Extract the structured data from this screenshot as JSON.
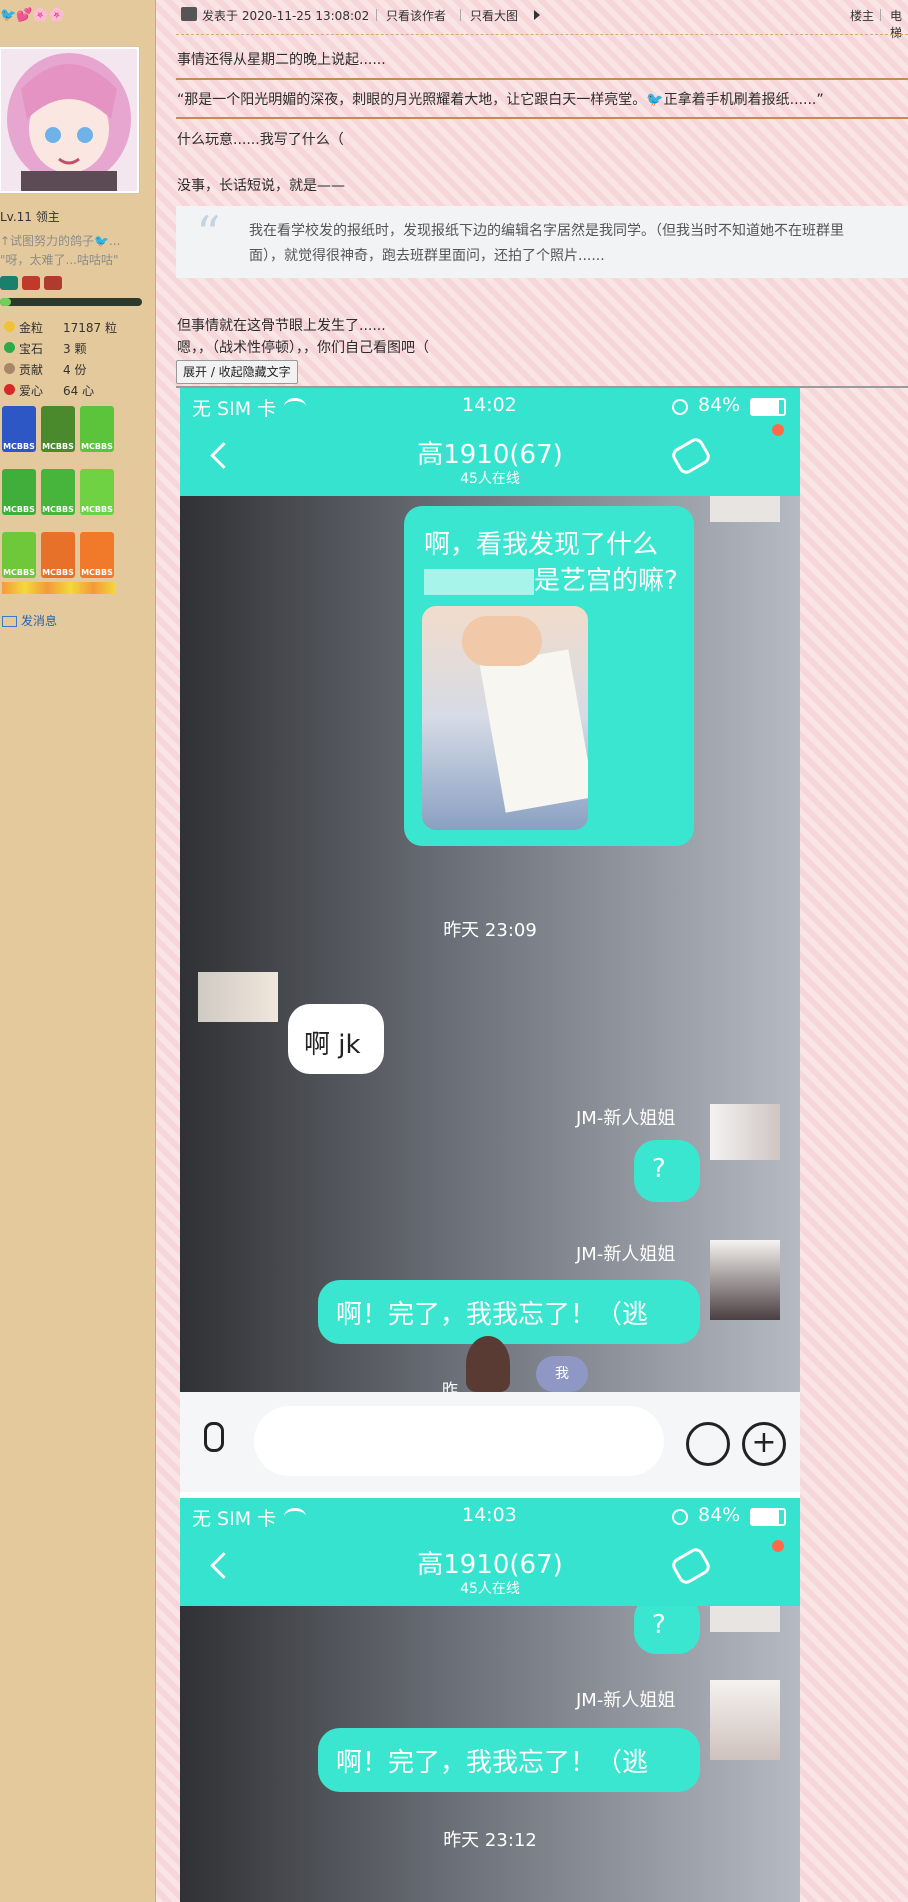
{
  "sidebar": {
    "level_text": "Lv.11 领主",
    "signature_line1": "↑试图努力的鸽子🐦...",
    "signature_line2": "\"呀，太难了...咕咕咕\"",
    "stats": [
      {
        "icon": "gold-icon",
        "label": "金粒",
        "value": "17187 粒"
      },
      {
        "icon": "gem-icon",
        "label": "宝石",
        "value": "3 颗"
      },
      {
        "icon": "contribution-icon",
        "label": "贡献",
        "value": "4 份"
      },
      {
        "icon": "heart-icon",
        "label": "爱心",
        "value": "64 心"
      }
    ],
    "badge_text": "MCBBS",
    "send_message": "发消息",
    "colors": {
      "bg": "#e4c99c",
      "accent": "#3a78c9"
    }
  },
  "post_header": {
    "posted_at": "发表于 2020-11-25 13:08:02",
    "only_author": "只看该作者",
    "only_big_images": "只看大图",
    "floor": "楼主",
    "right_cut": "电梯"
  },
  "post_body": {
    "p1": "事情还得从星期二的晚上说起......",
    "p2": "“那是一个阳光明媚的深夜，刺眼的月光照耀着大地，让它跟白天一样亮堂。🐦正拿着手机刷着报纸......”",
    "p3": "什么玩意......我写了什么（",
    "p4": "没事，长话短说，就是——",
    "quote_line1": "我在看学校发的报纸时，发现报纸下边的编辑名字居然是我同学。（但我当时不知道她不在班群里",
    "quote_line2": "面），就觉得很神奇，跑去班群里面问，还拍了个照片......",
    "p5": "但事情就在这骨节眼上发生了......",
    "p6": "嗯，，（战术性停顿），，你们自己看图吧（",
    "toggle_button": "展开 / 收起隐藏文字"
  },
  "screenshot1": {
    "carrier": "无 SIM 卡",
    "time": "14:02",
    "battery": "84%",
    "group_name": "高1910(67)",
    "online": "45人在线",
    "msg1_line1": "啊，看我发现了什么",
    "msg1_line2": "是艺宫的嘛?",
    "timestamp": "昨天 23:09",
    "msg2": "啊 jk",
    "sender": "JM-新人姐姐",
    "msg3": "?",
    "msg4": "啊！完了，我我忘了！（逃",
    "me_chip": "我",
    "cut_text": "昨"
  },
  "screenshot2": {
    "carrier": "无 SIM 卡",
    "time": "14:03",
    "battery": "84%",
    "group_name": "高1910(67)",
    "online": "45人在线",
    "msg_q": "?",
    "sender": "JM-新人姐姐",
    "msg": "啊！完了，我我忘了！（逃",
    "timestamp": "昨天 23:12"
  }
}
